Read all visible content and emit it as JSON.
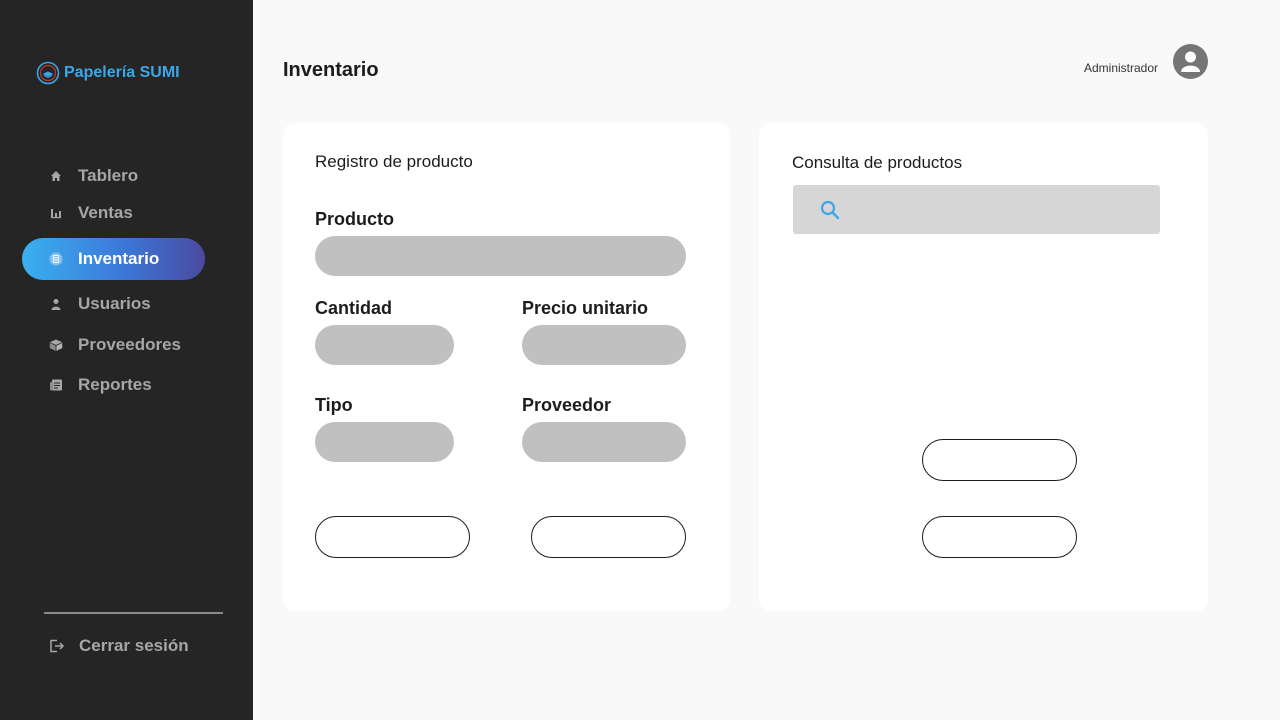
{
  "brand": {
    "name": "Papelería SUMI",
    "accent_color": "#3aa8e8",
    "logo_icon": "papeleria-logo-icon"
  },
  "sidebar": {
    "items": [
      {
        "label": "Tablero",
        "icon": "home-icon",
        "active": false
      },
      {
        "label": "Ventas",
        "icon": "bar-chart-icon",
        "active": false
      },
      {
        "label": "Inventario",
        "icon": "inventory-list-icon",
        "active": true
      },
      {
        "label": "Usuarios",
        "icon": "user-icon",
        "active": false
      },
      {
        "label": "Proveedores",
        "icon": "box-icon",
        "active": false
      },
      {
        "label": "Reportes",
        "icon": "report-icon",
        "active": false
      }
    ],
    "logout_label": "Cerrar sesión",
    "logout_icon": "logout-icon",
    "active_gradient": [
      "#3ab0f0",
      "#3c78d8",
      "#4a4aa0"
    ]
  },
  "header": {
    "title": "Inventario",
    "user_name": "Administrador",
    "avatar_icon": "user-avatar-icon"
  },
  "register_card": {
    "title": "Registro de producto",
    "fields": {
      "producto": {
        "label": "Producto",
        "value": ""
      },
      "cantidad": {
        "label": "Cantidad",
        "value": ""
      },
      "precio": {
        "label": "Precio unitario",
        "value": ""
      },
      "tipo": {
        "label": "Tipo",
        "value": ""
      },
      "proveedor": {
        "label": "Proveedor",
        "value": ""
      }
    },
    "buttons": [
      "",
      ""
    ]
  },
  "query_card": {
    "title": "Consulta de productos",
    "search_value": "",
    "search_icon": "search-icon",
    "buttons": [
      "",
      ""
    ]
  }
}
